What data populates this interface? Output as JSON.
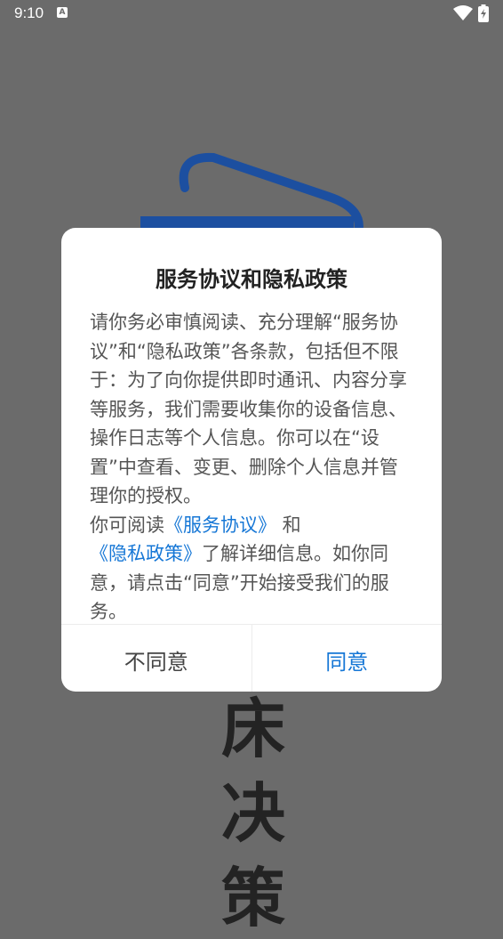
{
  "status_bar": {
    "time": "9:10",
    "notification_badge": "A",
    "icons": [
      "wifi-icon",
      "battery-icon"
    ]
  },
  "background": {
    "logo_icon": "hospital-logo-icon",
    "chars": [
      "床",
      "决",
      "策"
    ]
  },
  "dialog": {
    "title": "服务协议和隐私政策",
    "paragraph1": "请你务必审慎阅读、充分理解“服务协议”和“隐私政策”各条款，包括但不限于：为了向你提供即时通讯、内容分享等服务，我们需要收集你的设备信息、操作日志等个人信息。你可以在“设置”中查看、变更、删除个人信息并管理你的授权。",
    "p2_prefix": "你可阅读",
    "service_link": "《服务协议》",
    "p2_and": " 和",
    "privacy_link": "《隐私政策》",
    "p2_suffix": "了解详细信息。如你同意，请点击“同意”开始接受我们的服务。",
    "disagree_label": "不同意",
    "agree_label": "同意"
  },
  "colors": {
    "overlay": "#6b6b6b",
    "accent": "#1677d6",
    "logo_blue": "#1c4fa0"
  }
}
